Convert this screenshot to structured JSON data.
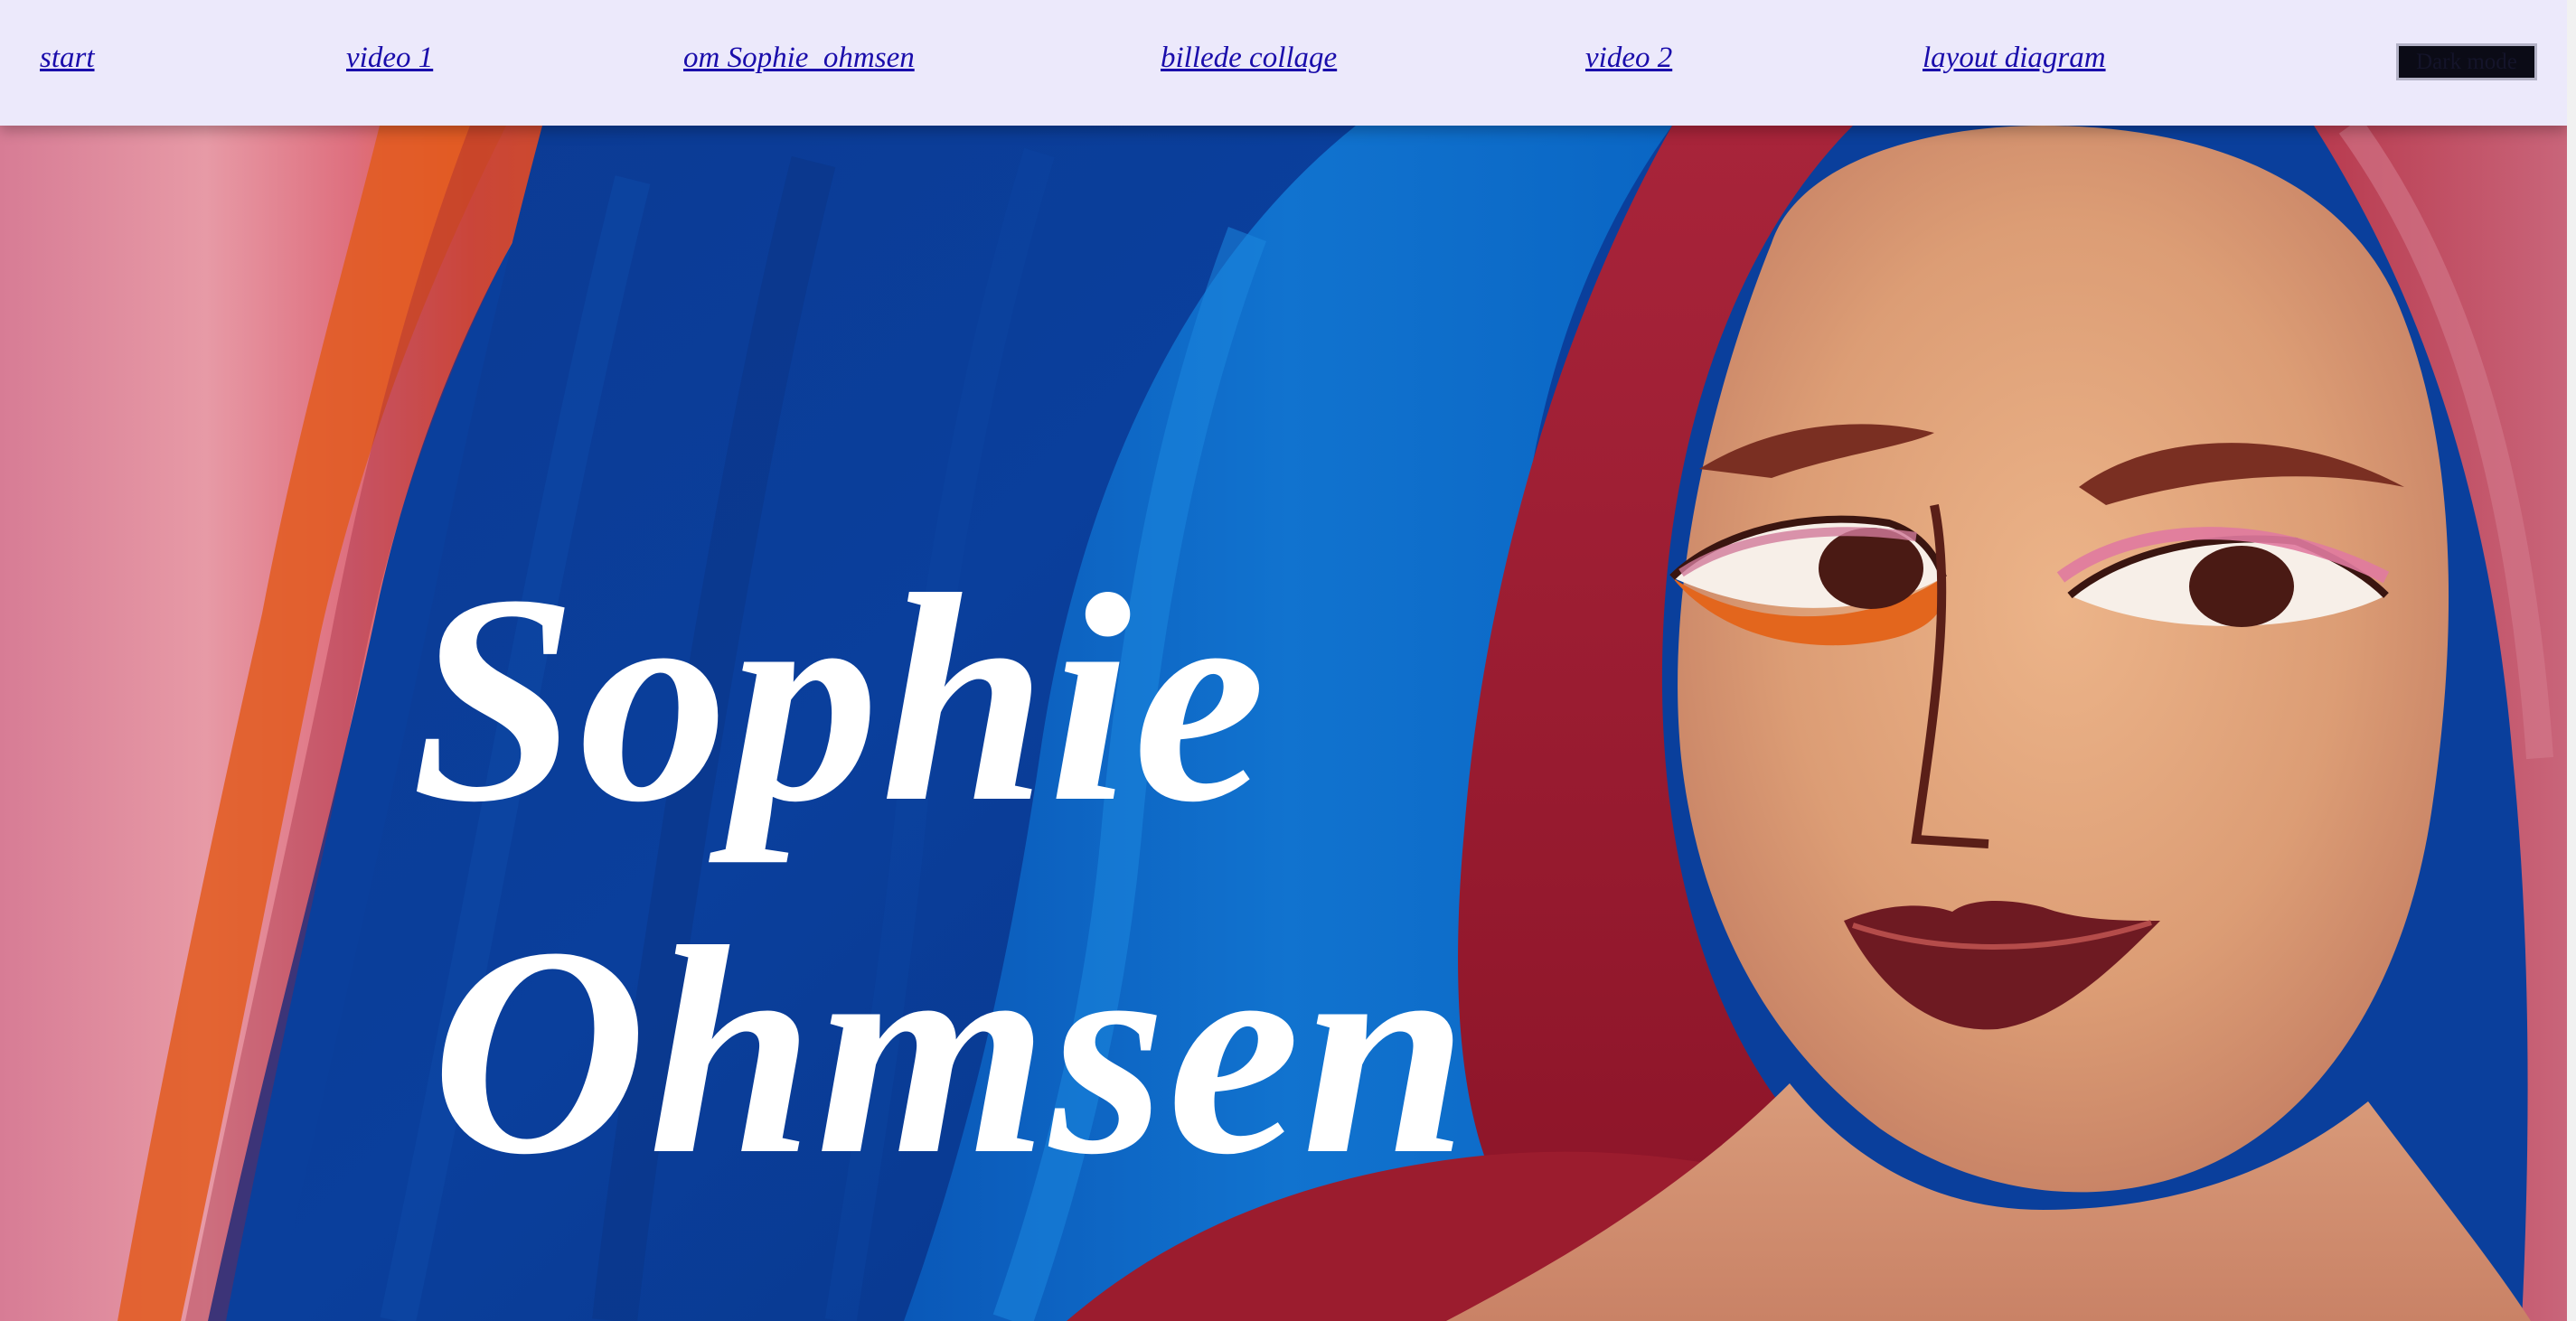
{
  "nav": {
    "links": [
      {
        "label": "start"
      },
      {
        "label": "video 1"
      },
      {
        "label": "om Sophie_ohmsen"
      },
      {
        "label": "billede collage"
      },
      {
        "label": "video 2"
      },
      {
        "label": "layout diagram"
      }
    ],
    "dark_mode_label": "Dark mode"
  },
  "hero": {
    "title_line1": "Sophie",
    "title_line2": "Ohmsen"
  },
  "colors": {
    "nav_background": "#ece9fb",
    "link_color": "#1a0dab",
    "title_color": "#ffffff"
  }
}
